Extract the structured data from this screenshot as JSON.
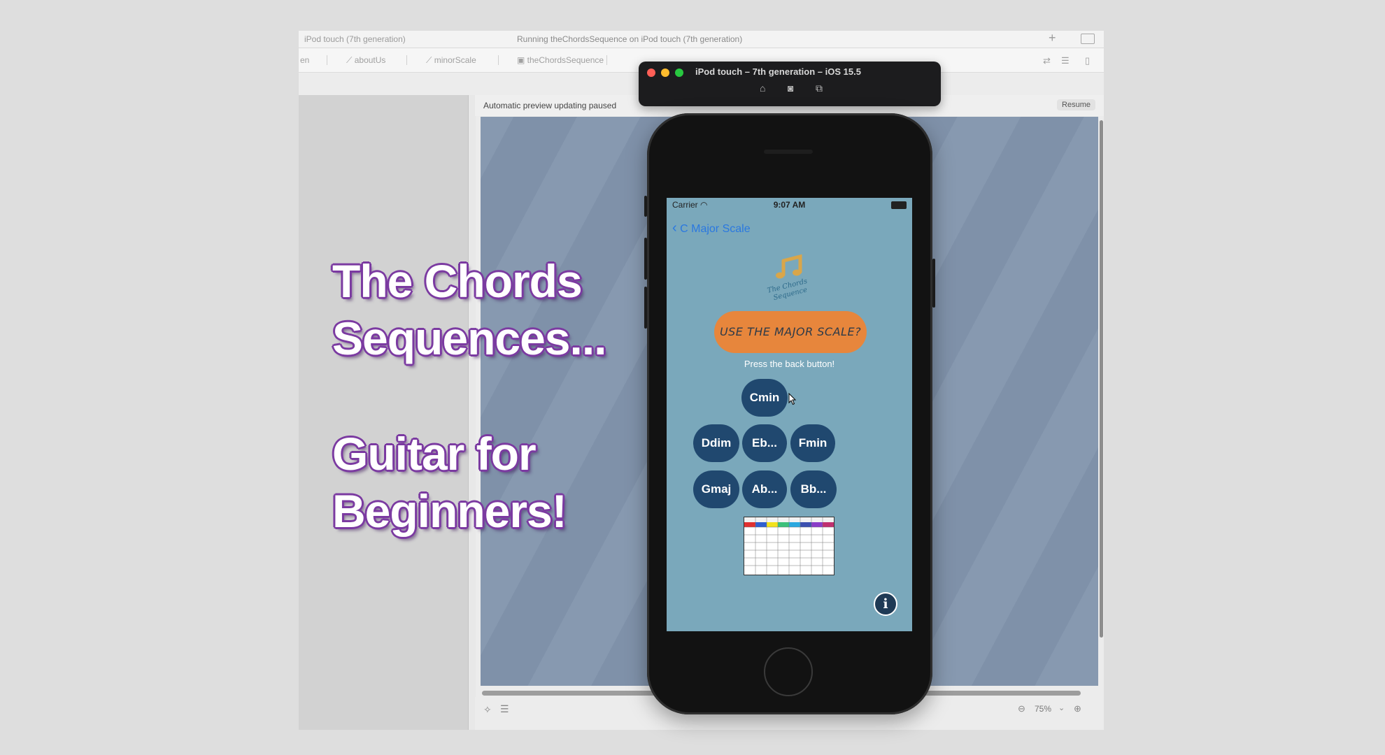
{
  "xcode": {
    "titlebar": {
      "device_label": "iPod touch (7th generation)",
      "status": "Running theChordsSequence on iPod touch (7th generation)"
    },
    "tabs": [
      "en",
      "aboutUs",
      "minorScale",
      "theChordsSequence"
    ],
    "preview": {
      "message": "Automatic preview updating paused",
      "resume_label": "Resume"
    },
    "zoom": "75%"
  },
  "simulator": {
    "title": "iPod touch – 7th generation – iOS 15.5",
    "icons": [
      "home-icon",
      "screenshot-icon",
      "rotate-icon"
    ]
  },
  "app": {
    "status": {
      "carrier": "Carrier",
      "time": "9:07 AM"
    },
    "back_label": "C Major Scale",
    "logo_text": "The Chords Sequence",
    "use_button": "USE THE MAJOR SCALE?",
    "hint": "Press the back button!",
    "chords_row1": [
      "Cmin"
    ],
    "chords_row2": [
      "Ddim",
      "Eb...",
      "Fmin"
    ],
    "chords_row3": [
      "Gmaj",
      "Ab...",
      "Bb..."
    ],
    "info_icon": "i"
  },
  "overlay": {
    "line1": "The Chords",
    "line2": "Sequences...",
    "line3": "Guitar for",
    "line4": "Beginners!"
  },
  "colors": {
    "screen_bg": "#7aa8bb",
    "chord_button": "#20486f",
    "use_button": "#e7863c",
    "overlay_outline": "#7b3aa1"
  }
}
